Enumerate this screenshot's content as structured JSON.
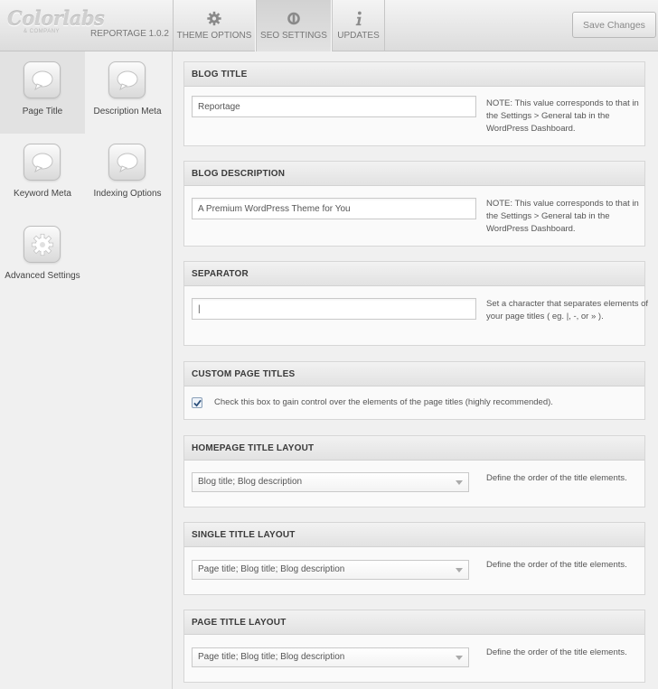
{
  "header": {
    "logo": "Colorlabs",
    "logo_sub": "& COMPANY",
    "version": "REPORTAGE 1.0.2",
    "tabs": [
      {
        "label": "THEME OPTIONS",
        "icon": "gear-icon"
      },
      {
        "label": "SEO SETTINGS",
        "icon": "seo-icon",
        "active": true
      },
      {
        "label": "UPDATES",
        "icon": "info-icon"
      }
    ],
    "save_label": "Save Changes"
  },
  "sidebar": {
    "items": [
      {
        "label": "Page Title",
        "icon": "speech-bubble-icon",
        "active": true
      },
      {
        "label": "Description Meta",
        "icon": "speech-bubble-icon"
      },
      {
        "label": "Keyword Meta",
        "icon": "speech-bubble-icon"
      },
      {
        "label": "Indexing Options",
        "icon": "speech-bubble-icon"
      },
      {
        "label": "Advanced Settings",
        "icon": "gear-icon"
      }
    ]
  },
  "sections": {
    "blog_title": {
      "heading": "BLOG TITLE",
      "value": "Reportage",
      "note": "NOTE: This value corresponds to that in the Settings > General tab in the WordPress Dashboard."
    },
    "blog_description": {
      "heading": "BLOG DESCRIPTION",
      "value": "A Premium WordPress Theme for You",
      "note": "NOTE: This value corresponds to that in the Settings > General tab in the WordPress Dashboard."
    },
    "separator": {
      "heading": "SEPARATOR",
      "value": "|",
      "note": "Set a character that separates elements of your page titles ( eg. |, -, or » )."
    },
    "custom_page_titles": {
      "heading": "CUSTOM PAGE TITLES",
      "checked": true,
      "label": "Check this box to gain control over the elements of the page titles (highly recommended)."
    },
    "homepage_title_layout": {
      "heading": "HOMEPAGE TITLE LAYOUT",
      "selected": "Blog title; Blog description",
      "note": "Define the order of the title elements."
    },
    "single_title_layout": {
      "heading": "SINGLE TITLE LAYOUT",
      "selected": "Page title; Blog title; Blog description",
      "note": "Define the order of the title elements."
    },
    "page_title_layout": {
      "heading": "PAGE TITLE LAYOUT",
      "selected": "Page title; Blog title; Blog description",
      "note": "Define the order of the title elements."
    }
  },
  "colors": {
    "header_bg": "#e4e4e4",
    "sidebar_bg": "#f0f0f0",
    "active_item_bg": "#e2e2e2",
    "panel_head_bg": "#e8e8e8"
  }
}
